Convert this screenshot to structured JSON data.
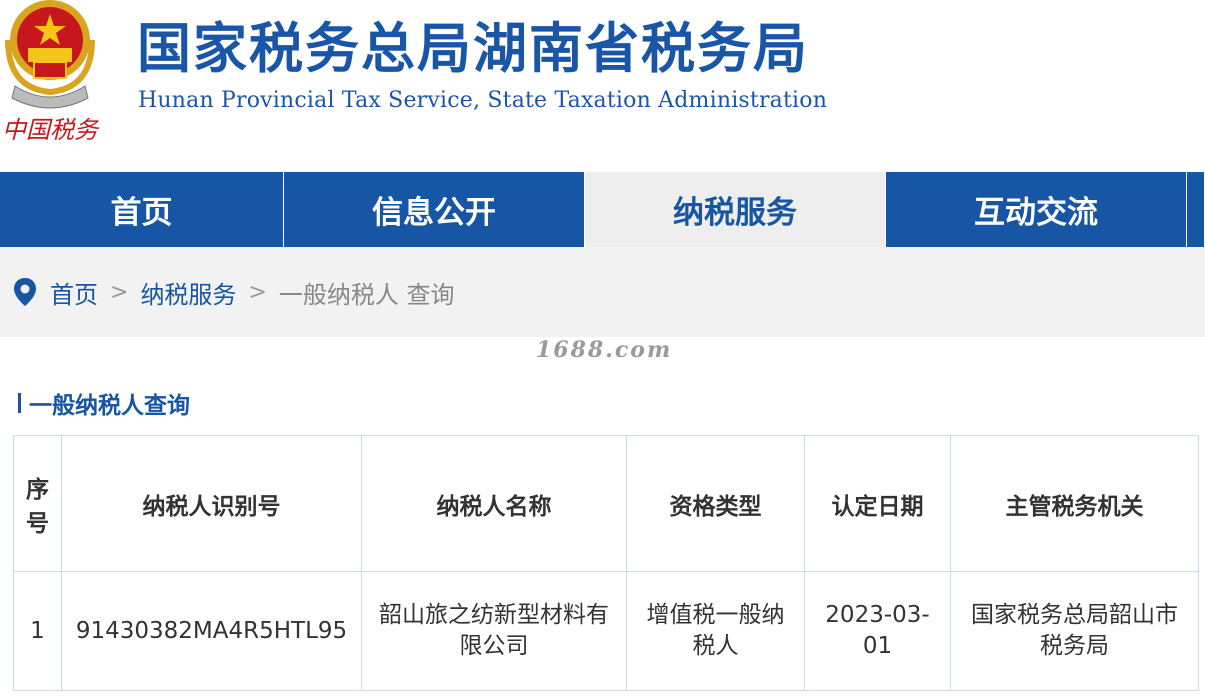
{
  "header": {
    "title": "国家税务总局湖南省税务局",
    "subtitle": "Hunan Provincial  Tax Service,  State Taxation Administration",
    "logo_text": "中国税务",
    "emblem_icon": "national-emblem-icon",
    "brand_color": "#1656a5"
  },
  "nav": {
    "items": [
      {
        "label": "首页"
      },
      {
        "label": "信息公开"
      },
      {
        "label": "纳税服务",
        "active": true
      },
      {
        "label": "互动交流"
      }
    ]
  },
  "breadcrumb": {
    "icon": "location-pin-icon",
    "home": "首页",
    "separator": ">",
    "section": "纳税服务",
    "current": "一般纳税人 查询"
  },
  "watermark": "1688.com",
  "page": {
    "section_title": "一般纳税人查询"
  },
  "table": {
    "headers": [
      "序号",
      "纳税人识别号",
      "纳税人名称",
      "资格类型",
      "认定日期",
      "主管税务机关"
    ],
    "rows": [
      [
        "1",
        "91430382MA4R5HTL95",
        "韶山旅之纺新型材料有限公司",
        "增值税一般纳税人",
        "2023-03-01",
        "国家税务总局韶山市税务局"
      ]
    ]
  }
}
